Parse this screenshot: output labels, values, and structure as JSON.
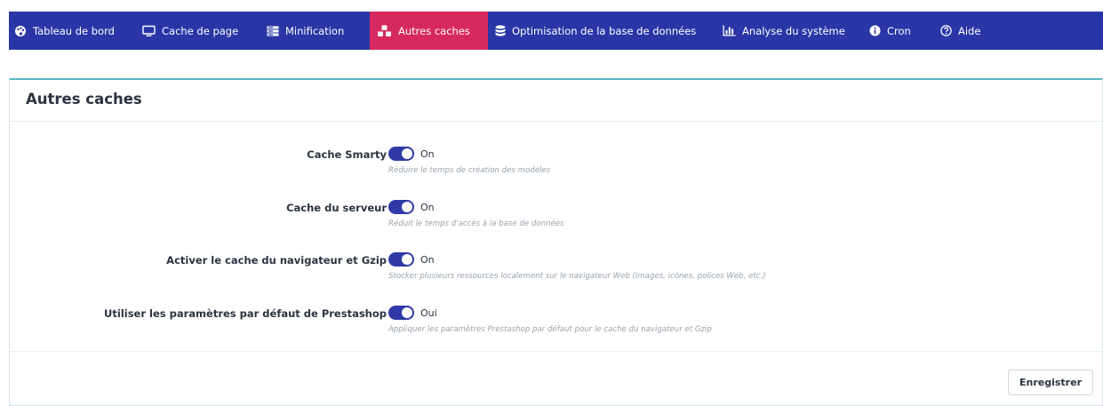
{
  "nav": {
    "items": [
      {
        "label": "Tableau de bord",
        "icon": "palette-icon"
      },
      {
        "label": "Cache de page",
        "icon": "monitor-icon"
      },
      {
        "label": "Minification",
        "icon": "server-icon"
      },
      {
        "label": "Autres caches",
        "icon": "cubes-icon",
        "active": true
      },
      {
        "label": "Optimisation de la base de données",
        "icon": "database-icon"
      },
      {
        "label": "Analyse du système",
        "icon": "bar-chart-icon"
      },
      {
        "label": "Cron",
        "icon": "info-icon"
      },
      {
        "label": "Aide",
        "icon": "question-icon"
      }
    ]
  },
  "panel": {
    "title": "Autres caches",
    "rows": [
      {
        "label": "Cache Smarty",
        "state": "On",
        "help": "Réduire le temps de création des modèles"
      },
      {
        "label": "Cache du serveur",
        "state": "On",
        "help": "Réduit le temps d'accès à la base de données"
      },
      {
        "label": "Activer le cache du navigateur et Gzip",
        "state": "On",
        "help": "Stocker plusieurs ressources localement sur le navigateur Web (images, icônes, polices Web, etc.)"
      },
      {
        "label": "Utiliser les paramètres par défaut de Prestashop",
        "state": "Oui",
        "help": "Appliquer les paramètres Prestashop par défaut pour le cache du navigateur et Gzip"
      }
    ],
    "save_label": "Enregistrer"
  },
  "colors": {
    "nav_bg": "#2a36a6",
    "active_tab": "#d6295e",
    "switch_on": "#2f3aa6",
    "panel_accent": "#5bb8c8"
  }
}
